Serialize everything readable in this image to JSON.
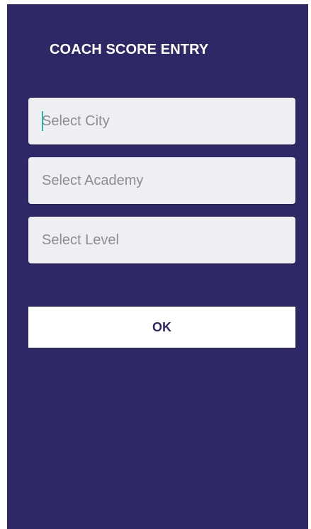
{
  "header": {
    "title": "COACH SCORE ENTRY"
  },
  "form": {
    "city": {
      "value": "",
      "placeholder": "Select City",
      "focused": true
    },
    "academy": {
      "value": "",
      "placeholder": "Select Academy"
    },
    "level": {
      "value": "",
      "placeholder": "Select Level"
    }
  },
  "actions": {
    "ok_label": "OK"
  },
  "colors": {
    "background": "#2f2866",
    "field_background": "#efeff1",
    "cursor": "#1fb6b3",
    "button_background": "#ffffff"
  }
}
